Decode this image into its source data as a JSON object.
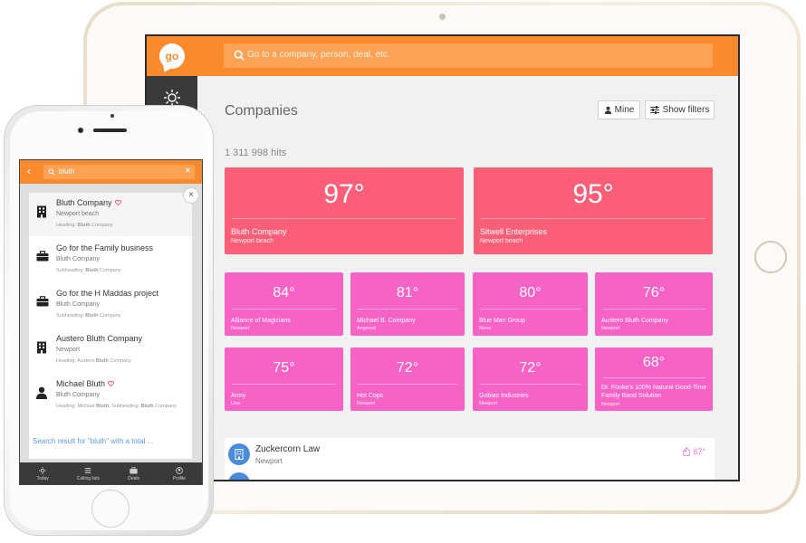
{
  "tablet": {
    "logo": "go",
    "search_placeholder": "Go to a company, person, deal, etc.",
    "page_title": "Companies",
    "mine_label": "Mine",
    "filters_label": "Show filters",
    "hits": "1 311 998 hits",
    "top_cards": [
      {
        "temp": "97°",
        "name": "Bluth Company",
        "location": "Newport beach"
      },
      {
        "temp": "95°",
        "name": "Sitwell Enterprises",
        "location": "Newport beach"
      }
    ],
    "grid_cards": [
      {
        "temp": "84°",
        "name": "Alliance of Magicians",
        "location": "Newport"
      },
      {
        "temp": "81°",
        "name": "Michael B. Company",
        "location": "Angered"
      },
      {
        "temp": "80°",
        "name": "Blue Man Group",
        "location": "Reno"
      },
      {
        "temp": "76°",
        "name": "Austero Bluth Company",
        "location": "Newport"
      },
      {
        "temp": "75°",
        "name": "Army",
        "location": "Usa"
      },
      {
        "temp": "72°",
        "name": "Hot Cops",
        "location": "Newport"
      },
      {
        "temp": "72°",
        "name": "Gobias Industries",
        "location": "Newport"
      },
      {
        "temp": "68°",
        "name": "Dr. Fünke's 100% Natural Good-Time Family Band Solution",
        "location": "Newport"
      }
    ],
    "list_item": {
      "name": "Zuckercorn Law",
      "location": "Newport",
      "temp": "67°"
    },
    "colors": {
      "accent": "#fa8a2e",
      "big_card": "#fb5f78",
      "grid_card": "#f762c6"
    }
  },
  "phone": {
    "search_value": "bluth",
    "results": [
      {
        "title": "Bluth Company",
        "sub": "Newport beach",
        "meta_pre": "Heading: ",
        "meta_bold": "Bluth",
        "meta_post": " Company",
        "icon": "building-icon",
        "heart": true
      },
      {
        "title": "Go for the Family business",
        "sub": "Bluth Company",
        "meta_pre": "Subheading: ",
        "meta_bold": "Bluth",
        "meta_post": " Company",
        "icon": "briefcase-icon",
        "heart": false
      },
      {
        "title": "Go for the H Maddas project",
        "sub": "Bluth Company",
        "meta_pre": "Subheading: ",
        "meta_bold": "Bluth",
        "meta_post": " Company",
        "icon": "briefcase-icon",
        "heart": false
      },
      {
        "title": "Austero Bluth Company",
        "sub": "Newport",
        "meta_pre": "Heading: Austero ",
        "meta_bold": "Bluth",
        "meta_post": " Company",
        "icon": "building-icon",
        "heart": false
      },
      {
        "title": "Michael Bluth",
        "sub": "Bluth Company",
        "meta_pre": "Heading: Michael ",
        "meta_bold": "Bluth",
        "meta_post": ", Subheading: ",
        "meta_bold2": "Bluth",
        "meta_post2": " Company",
        "icon": "person-icon",
        "heart": true
      }
    ],
    "more_results": "Search result for \"bluth\" with a total ...",
    "tabs": [
      {
        "label": "Today",
        "icon": "sun-icon"
      },
      {
        "label": "Calling lists",
        "icon": "list-icon"
      },
      {
        "label": "Deals",
        "icon": "briefcase-icon"
      },
      {
        "label": "Profile",
        "icon": "profile-icon"
      }
    ]
  }
}
